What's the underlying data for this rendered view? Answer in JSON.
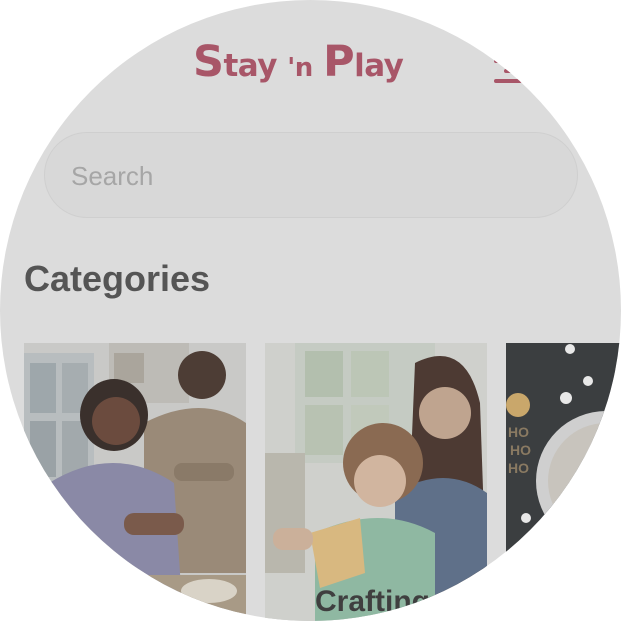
{
  "app": {
    "logo_part1": "S",
    "logo_part2": "tay",
    "logo_part3": "'n",
    "logo_part4": "P",
    "logo_part5": "lay"
  },
  "search": {
    "placeholder": "Search"
  },
  "categories": {
    "title": "Categories",
    "items": [
      {
        "label": ""
      },
      {
        "label": "Crafting"
      },
      {
        "label": ""
      }
    ]
  },
  "colors": {
    "brand": "#a85668",
    "background": "#dcdcdc"
  }
}
